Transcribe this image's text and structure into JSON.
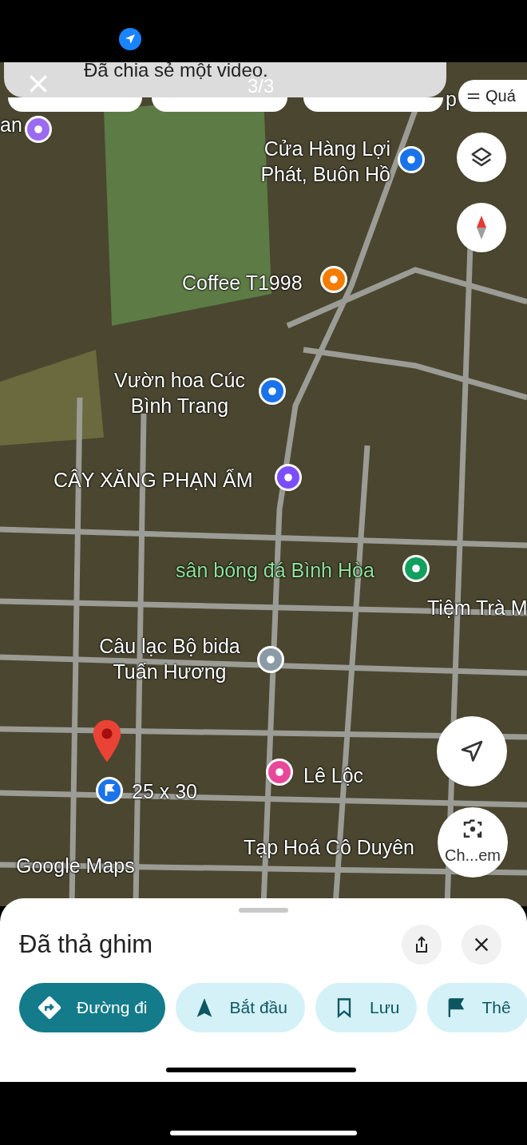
{
  "notification": {
    "text": "Đã chia sẻ một video.",
    "counter": "3/3"
  },
  "category_chips": [
    {
      "label": "Quá"
    }
  ],
  "map_labels": [
    {
      "text": "an",
      "kind": "edge",
      "color": "#9b6bf2"
    },
    {
      "text": "p",
      "kind": "plain"
    },
    {
      "text": "Cửa Hàng Lợi Phát, Buôn Hồ",
      "kind": "place",
      "color": "#1a73e8"
    },
    {
      "text": "Coffee T1998",
      "kind": "place",
      "color": "#f57c00"
    },
    {
      "text": "Vườn hoa Cúc Bình Trang",
      "kind": "place",
      "color": "#1a73e8"
    },
    {
      "text": "CÂY XĂNG PHẠN ẨM",
      "kind": "place",
      "color": "#7c4dff"
    },
    {
      "text": "sân bóng đá Bình Hòa",
      "kind": "park",
      "color": "#13a05f"
    },
    {
      "text": "Tiệm Trà M",
      "kind": "plain"
    },
    {
      "text": "Câu lạc Bộ bida Tuấn Hương",
      "kind": "place",
      "color": "#8a9aa6"
    },
    {
      "text": "25 x 30",
      "kind": "dropped",
      "color": "#1a73e8"
    },
    {
      "text": "Lê Lộc",
      "kind": "place",
      "color": "#e8489a"
    },
    {
      "text": "Tạp Hoá Cô Duyên",
      "kind": "plain"
    }
  ],
  "map_logo": "Google Maps",
  "camera_button": {
    "label": "Ch...em"
  },
  "sheet": {
    "title": "Đã thả ghim",
    "actions": [
      {
        "label": "Đường đi",
        "kind": "primary"
      },
      {
        "label": "Bắt đầu",
        "kind": "secondary"
      },
      {
        "label": "Lưu",
        "kind": "secondary"
      },
      {
        "label": "Thê",
        "kind": "secondary"
      }
    ]
  }
}
